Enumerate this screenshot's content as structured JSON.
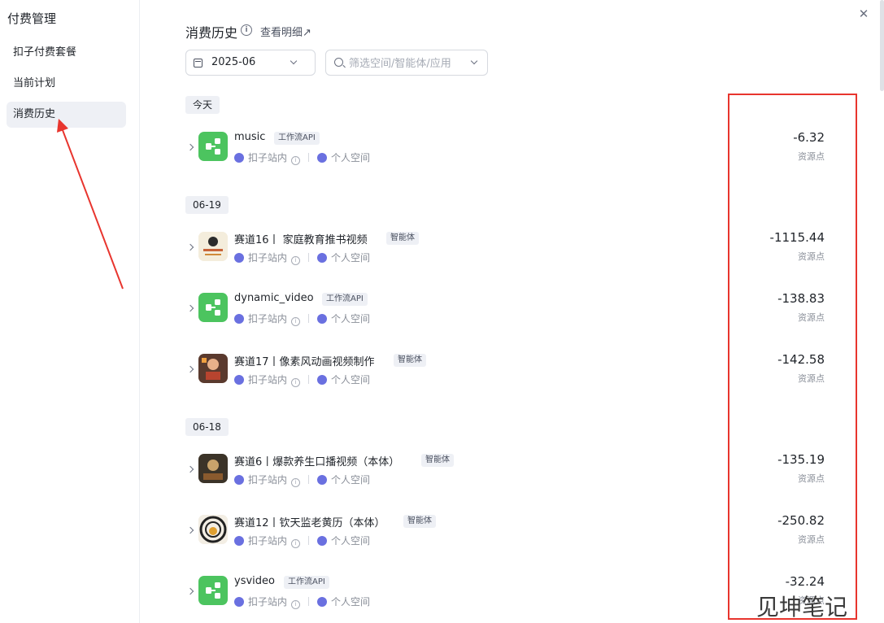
{
  "sidebar": {
    "title": "付费管理",
    "items": [
      {
        "label": "扣子付费套餐",
        "active": false
      },
      {
        "label": "当前计划",
        "active": false
      },
      {
        "label": "消费历史",
        "active": true
      }
    ]
  },
  "header": {
    "title": "消费历史",
    "info_icon": "info-icon",
    "detail_link": "查看明细↗",
    "close_icon": "✕"
  },
  "filters": {
    "month": "2025-06",
    "search_placeholder": "筛选空间/智能体/应用"
  },
  "common": {
    "source": "扣子站内",
    "space": "个人空间",
    "unit": "资源点"
  },
  "groups": [
    {
      "date": "今天",
      "records": [
        {
          "name": "music",
          "tag": "工作流API",
          "type": "workflow",
          "amount": "-6.32"
        }
      ]
    },
    {
      "date": "06-19",
      "records": [
        {
          "name": "赛道16丨 家庭教育推书视频",
          "tag": "智能体",
          "type": "agent",
          "amount": "-1115.44"
        },
        {
          "name": "dynamic_video",
          "tag": "工作流API",
          "type": "workflow",
          "amount": "-138.83"
        },
        {
          "name": "赛道17丨像素风动画视频制作",
          "tag": "智能体",
          "type": "agent",
          "amount": "-142.58"
        }
      ]
    },
    {
      "date": "06-18",
      "records": [
        {
          "name": "赛道6丨爆款养生口播视频（本体）",
          "tag": "智能体",
          "type": "agent",
          "amount": "-135.19"
        },
        {
          "name": "赛道12丨钦天监老黄历（本体）",
          "tag": "智能体",
          "type": "agent",
          "amount": "-250.82"
        },
        {
          "name": "ysvideo",
          "tag": "工作流API",
          "type": "workflow",
          "amount": "-32.24"
        }
      ]
    }
  ],
  "annotation": {
    "watermark": "见坤笔记",
    "highlight_color": "#e8352e"
  }
}
